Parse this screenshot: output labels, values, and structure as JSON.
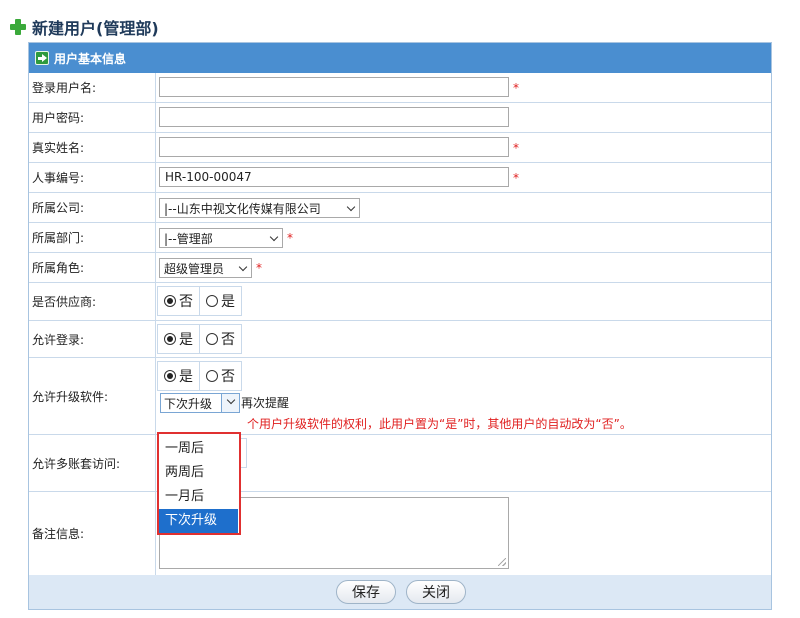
{
  "page": {
    "title": "新建用户(管理部)"
  },
  "section": {
    "title": "用户基本信息"
  },
  "fields": {
    "login_name": {
      "label": "登录用户名:",
      "value": "",
      "required": "*"
    },
    "password": {
      "label": "用户密码:",
      "value": ""
    },
    "real_name": {
      "label": "真实姓名:",
      "value": "",
      "required": "*"
    },
    "hr_number": {
      "label": "人事编号:",
      "value": "HR-100-00047",
      "required": "*"
    },
    "company": {
      "label": "所属公司:",
      "selected": "|--山东中视文化传媒有限公司"
    },
    "department": {
      "label": "所属部门:",
      "selected": "|--管理部",
      "required": "*"
    },
    "role": {
      "label": "所属角色:",
      "selected": "超级管理员",
      "required": "*"
    },
    "is_supplier": {
      "label": "是否供应商:",
      "options": [
        "否",
        "是"
      ],
      "checked": "否"
    },
    "allow_login": {
      "label": "允许登录:",
      "options": [
        "是",
        "否"
      ],
      "checked": "是"
    },
    "allow_upgrade": {
      "label": "允许升级软件:",
      "options": [
        "是",
        "否"
      ],
      "checked": "是",
      "remind_selected": "下次升级",
      "remind_suffix": "再次提醒",
      "hint": "个用户升级软件的权利，此用户置为“是”时，其他用户的自动改为“否”。",
      "dropdown_options": [
        "一周后",
        "两周后",
        "一月后",
        "下次升级"
      ]
    },
    "multi_account": {
      "label": "允许多账套访问:"
    },
    "remarks": {
      "label": "备注信息:",
      "value": ""
    }
  },
  "buttons": {
    "save": "保存",
    "close": "关闭"
  },
  "colors": {
    "header_bg": "#4a8ed0",
    "required": "#e02020",
    "highlight_border": "#e03030",
    "selected_option": "#1e6fcc"
  }
}
